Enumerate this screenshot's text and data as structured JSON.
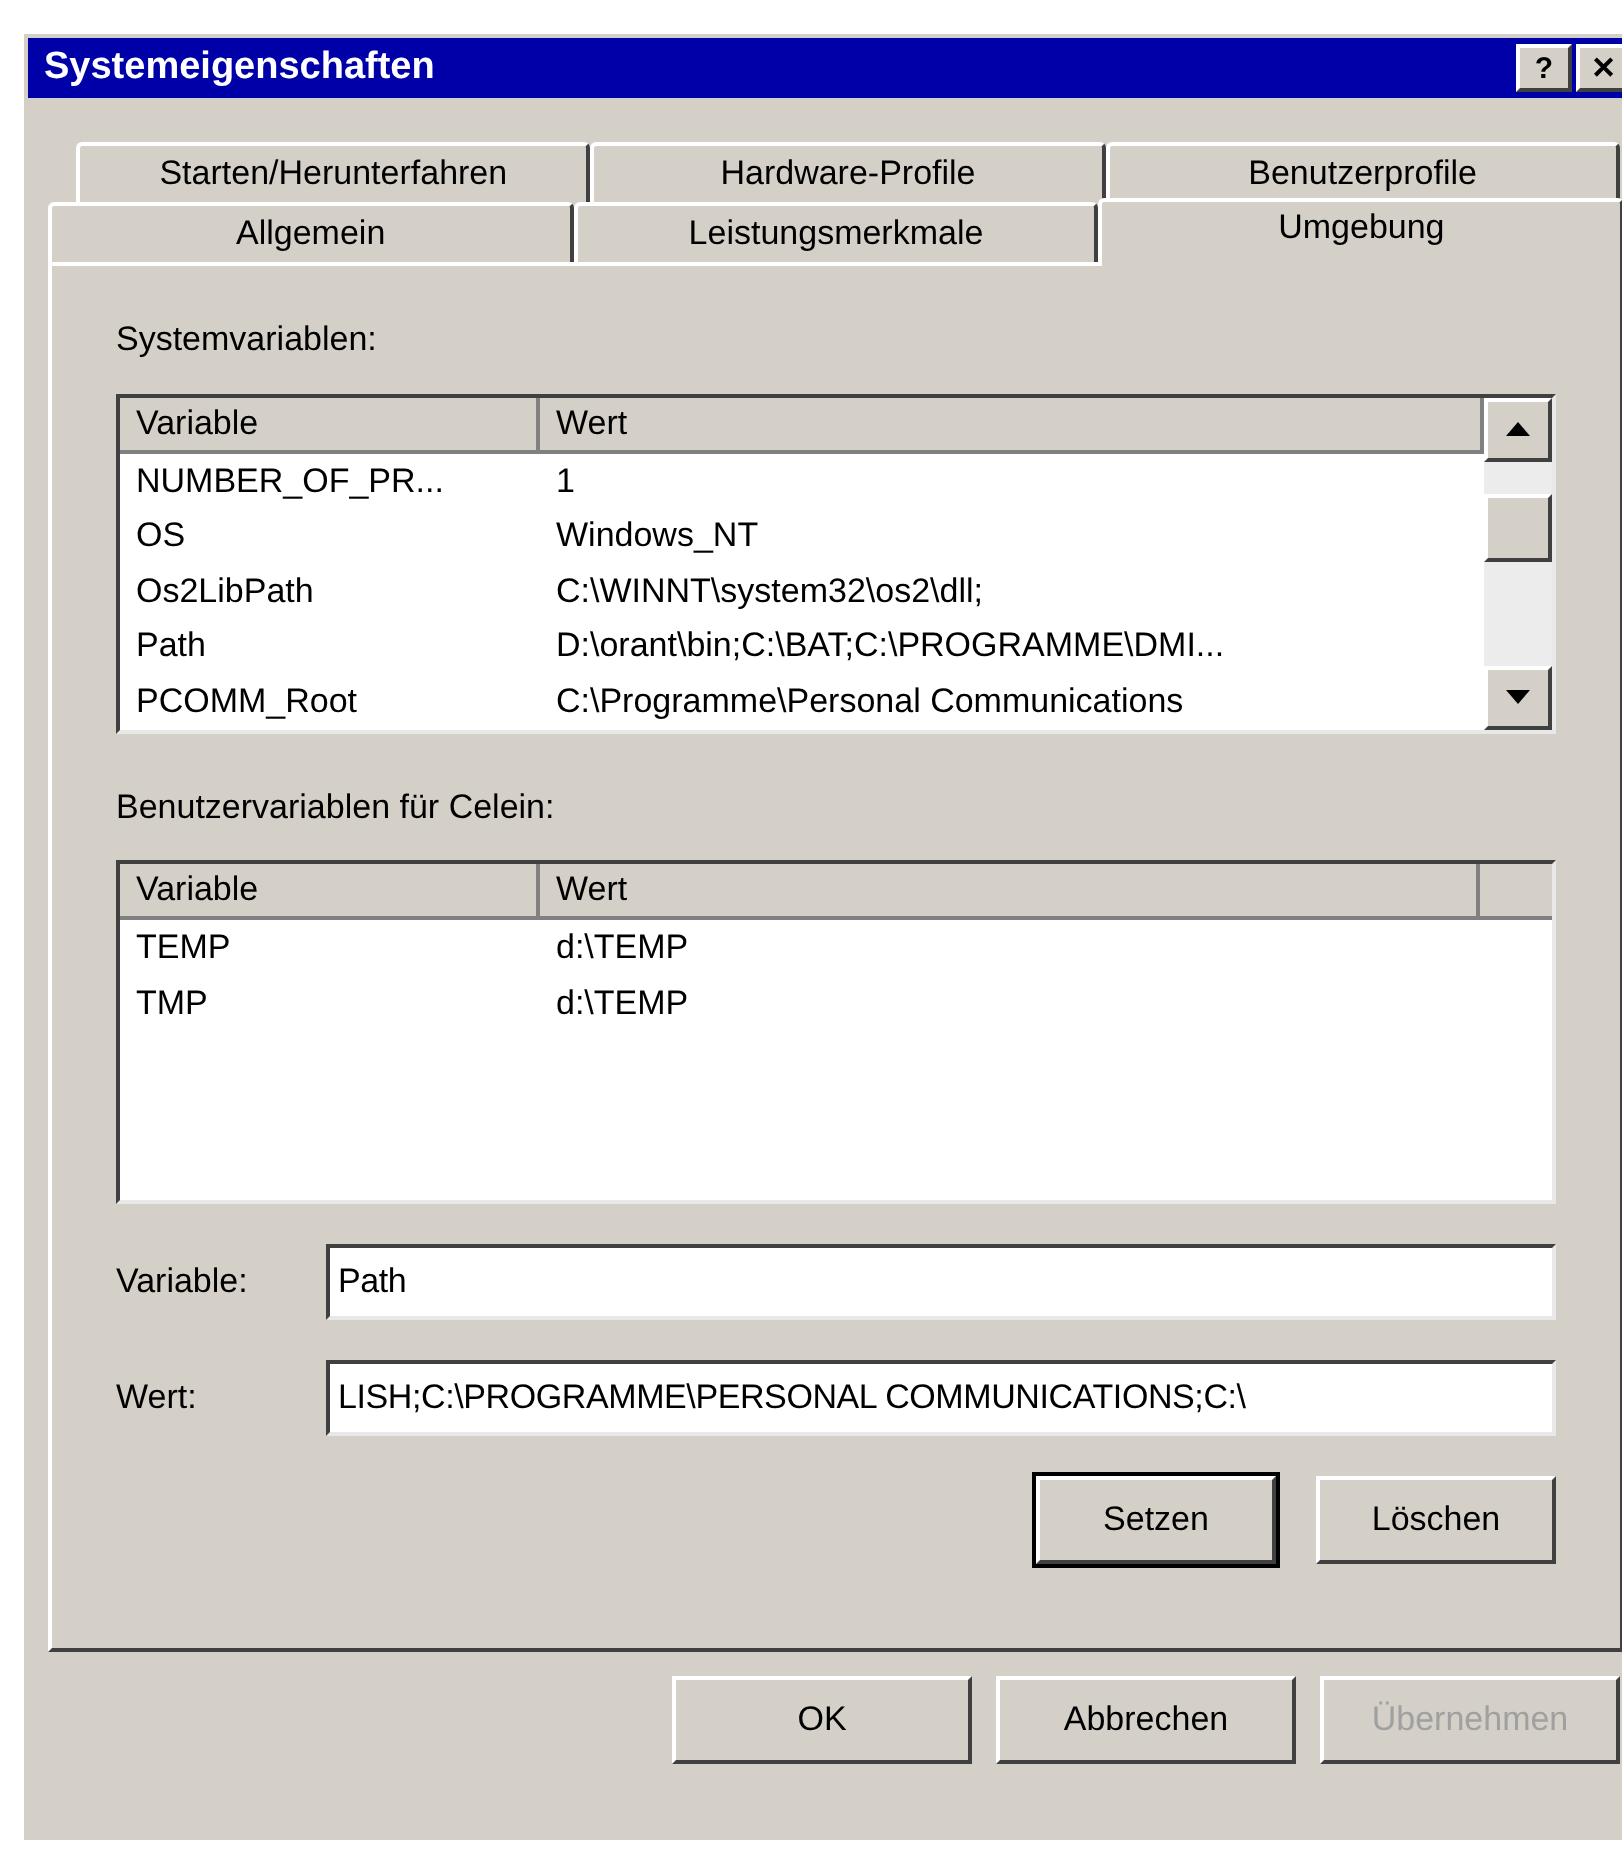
{
  "window": {
    "title": "Systemeigenschaften",
    "title_buttons": [
      "?",
      "✕"
    ]
  },
  "tab_rows": [
    [
      {
        "label": "Starten/Herunterfahren",
        "selected": false
      },
      {
        "label": "Hardware-Profile",
        "selected": false
      },
      {
        "label": "Benutzerprofile",
        "selected": false
      }
    ],
    [
      {
        "label": "Allgemein",
        "selected": false
      },
      {
        "label": "Leistungsmerkmale",
        "selected": false
      },
      {
        "label": "Umgebung",
        "selected": true
      }
    ]
  ],
  "system_variables": {
    "label": "Systemvariablen:",
    "columns": [
      "Variable",
      "Wert"
    ],
    "rows": [
      {
        "cells": [
          "NUMBER_OF_PR...",
          "1"
        ]
      },
      {
        "cells": [
          "OS",
          "Windows_NT"
        ]
      },
      {
        "cells": [
          "Os2LibPath",
          "C:\\WINNT\\system32\\os2\\dll;"
        ]
      },
      {
        "cells": [
          "Path",
          "D:\\orant\\bin;C:\\BAT;C:\\PROGRAMME\\DMI..."
        ]
      },
      {
        "cells": [
          "PCOMM_Root",
          "C:\\Programme\\Personal Communications"
        ]
      }
    ]
  },
  "user_variables": {
    "label": "Benutzervariablen für Celein:",
    "columns": [
      "Variable",
      "Wert"
    ],
    "rows": [
      {
        "cells": [
          "TEMP",
          "d:\\TEMP"
        ]
      },
      {
        "cells": [
          "TMP",
          "d:\\TEMP"
        ]
      }
    ]
  },
  "fields": [
    {
      "label": "Variable:",
      "value": "Path"
    },
    {
      "label": "Wert:",
      "value": "LISH;C:\\PROGRAMME\\PERSONAL COMMUNICATIONS;C:\\"
    }
  ],
  "edit_buttons": [
    {
      "label": "Setzen",
      "default": true,
      "disabled": false
    },
    {
      "label": "Löschen",
      "default": false,
      "disabled": false
    }
  ],
  "dialog_buttons": [
    {
      "label": "OK",
      "default": false,
      "disabled": false
    },
    {
      "label": "Abbrechen",
      "default": false,
      "disabled": false
    },
    {
      "label": "Übernehmen",
      "default": false,
      "disabled": true
    }
  ]
}
